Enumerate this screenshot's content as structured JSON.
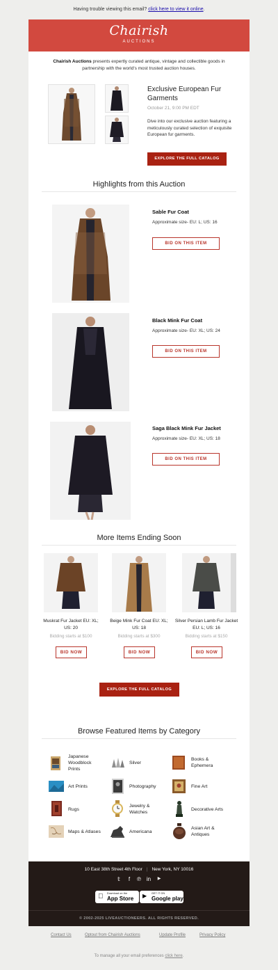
{
  "preheader": {
    "text": "Having trouble viewing this email?",
    "link": "click here to view it online",
    "suffix": "."
  },
  "brand": {
    "name": "Chairish",
    "sub": "AUCTIONS"
  },
  "intro": {
    "bold": "Chairish Auctions",
    "text": " presents expertly curated antique, vintage and collectible goods in partnership with the world's most trusted auction houses."
  },
  "hero": {
    "title": "Exclusive European Fur Garments",
    "date": "October 21, 9:00 PM EDT",
    "description": "Dive into our exclusive auction featuring a meticulously curated selection of exquisite European fur garments.",
    "cta": "EXPLORE THE FULL CATALOG"
  },
  "highlights": {
    "title": "Highlights from this Auction",
    "items": [
      {
        "name": "Sable Fur Coat",
        "size": "Approximate size- EU: L; US: 16",
        "cta": "BID ON THIS ITEM"
      },
      {
        "name": "Black Mink Fur Coat",
        "size": "Approximate size- EU: XL; US: 24",
        "cta": "BID ON THIS ITEM"
      },
      {
        "name": "Saga Black Mink Fur Jacket",
        "size": "Approximate size- EU: XL; US: 18",
        "cta": "BID ON THIS ITEM"
      }
    ]
  },
  "more": {
    "title": "More Items Ending Soon",
    "items": [
      {
        "name": "Muskrat Fur Jacket EU: XL; US: 20",
        "bid": "Bidding starts at $100",
        "cta": "BID NOW"
      },
      {
        "name": "Beige Mink Fur Coat EU: XL; US: 18",
        "bid": "Bidding starts at $300",
        "cta": "BID NOW"
      },
      {
        "name": "Silver Persian Lamb Fur Jacket EU: L; US: 16",
        "bid": "Bidding starts at $150",
        "cta": "BID NOW"
      }
    ],
    "cta": "EXPLORE THE FULL CATALOG"
  },
  "categories": {
    "title": "Browse Featured Items by Category",
    "items": [
      {
        "label": "Japanese Woodblock Prints",
        "icon": "woodblock-print-icon"
      },
      {
        "label": "Silver",
        "icon": "silver-icon"
      },
      {
        "label": "Books & Ephemera",
        "icon": "book-icon"
      },
      {
        "label": "Art Prints",
        "icon": "art-print-icon"
      },
      {
        "label": "Photography",
        "icon": "photography-icon"
      },
      {
        "label": "Fine Art",
        "icon": "fine-art-icon"
      },
      {
        "label": "Rugs",
        "icon": "rug-icon"
      },
      {
        "label": "Jewelry & Watches",
        "icon": "watch-icon"
      },
      {
        "label": "Decorative Arts",
        "icon": "decorative-arts-icon"
      },
      {
        "label": "Maps & Atlases",
        "icon": "map-icon"
      },
      {
        "label": "Americana",
        "icon": "americana-icon"
      },
      {
        "label": "Asian Art & Antiques",
        "icon": "asian-art-icon"
      }
    ]
  },
  "footer": {
    "address": "10 East 38th Street 4th Floor",
    "city": "New York, NY 10016",
    "social": [
      {
        "glyph": "𝕥",
        "icon": "twitter-icon"
      },
      {
        "glyph": "f",
        "icon": "facebook-icon"
      },
      {
        "glyph": "℗",
        "icon": "pinterest-icon"
      },
      {
        "glyph": "in",
        "icon": "linkedin-icon"
      },
      {
        "glyph": "▶",
        "icon": "youtube-icon"
      }
    ],
    "app_store": {
      "small": "Download on the",
      "big": "App Store"
    },
    "google_play": {
      "small": "GET IT ON",
      "big": "Google play"
    },
    "copyright": "© 2002-2025 LIVEAUCTIONEERS. ALL RIGHTS RESERVED.",
    "links": [
      "Contact Us",
      "Optout from Chairish Auctions",
      "Update Profile",
      "Privacy Policy"
    ],
    "manage_text": "To manage all your email preferences ",
    "manage_link": "click here",
    "manage_suffix": "."
  },
  "colors": {
    "brand_red": "#d2493f",
    "button_red": "#a92212",
    "footer_bg": "#231a17"
  }
}
